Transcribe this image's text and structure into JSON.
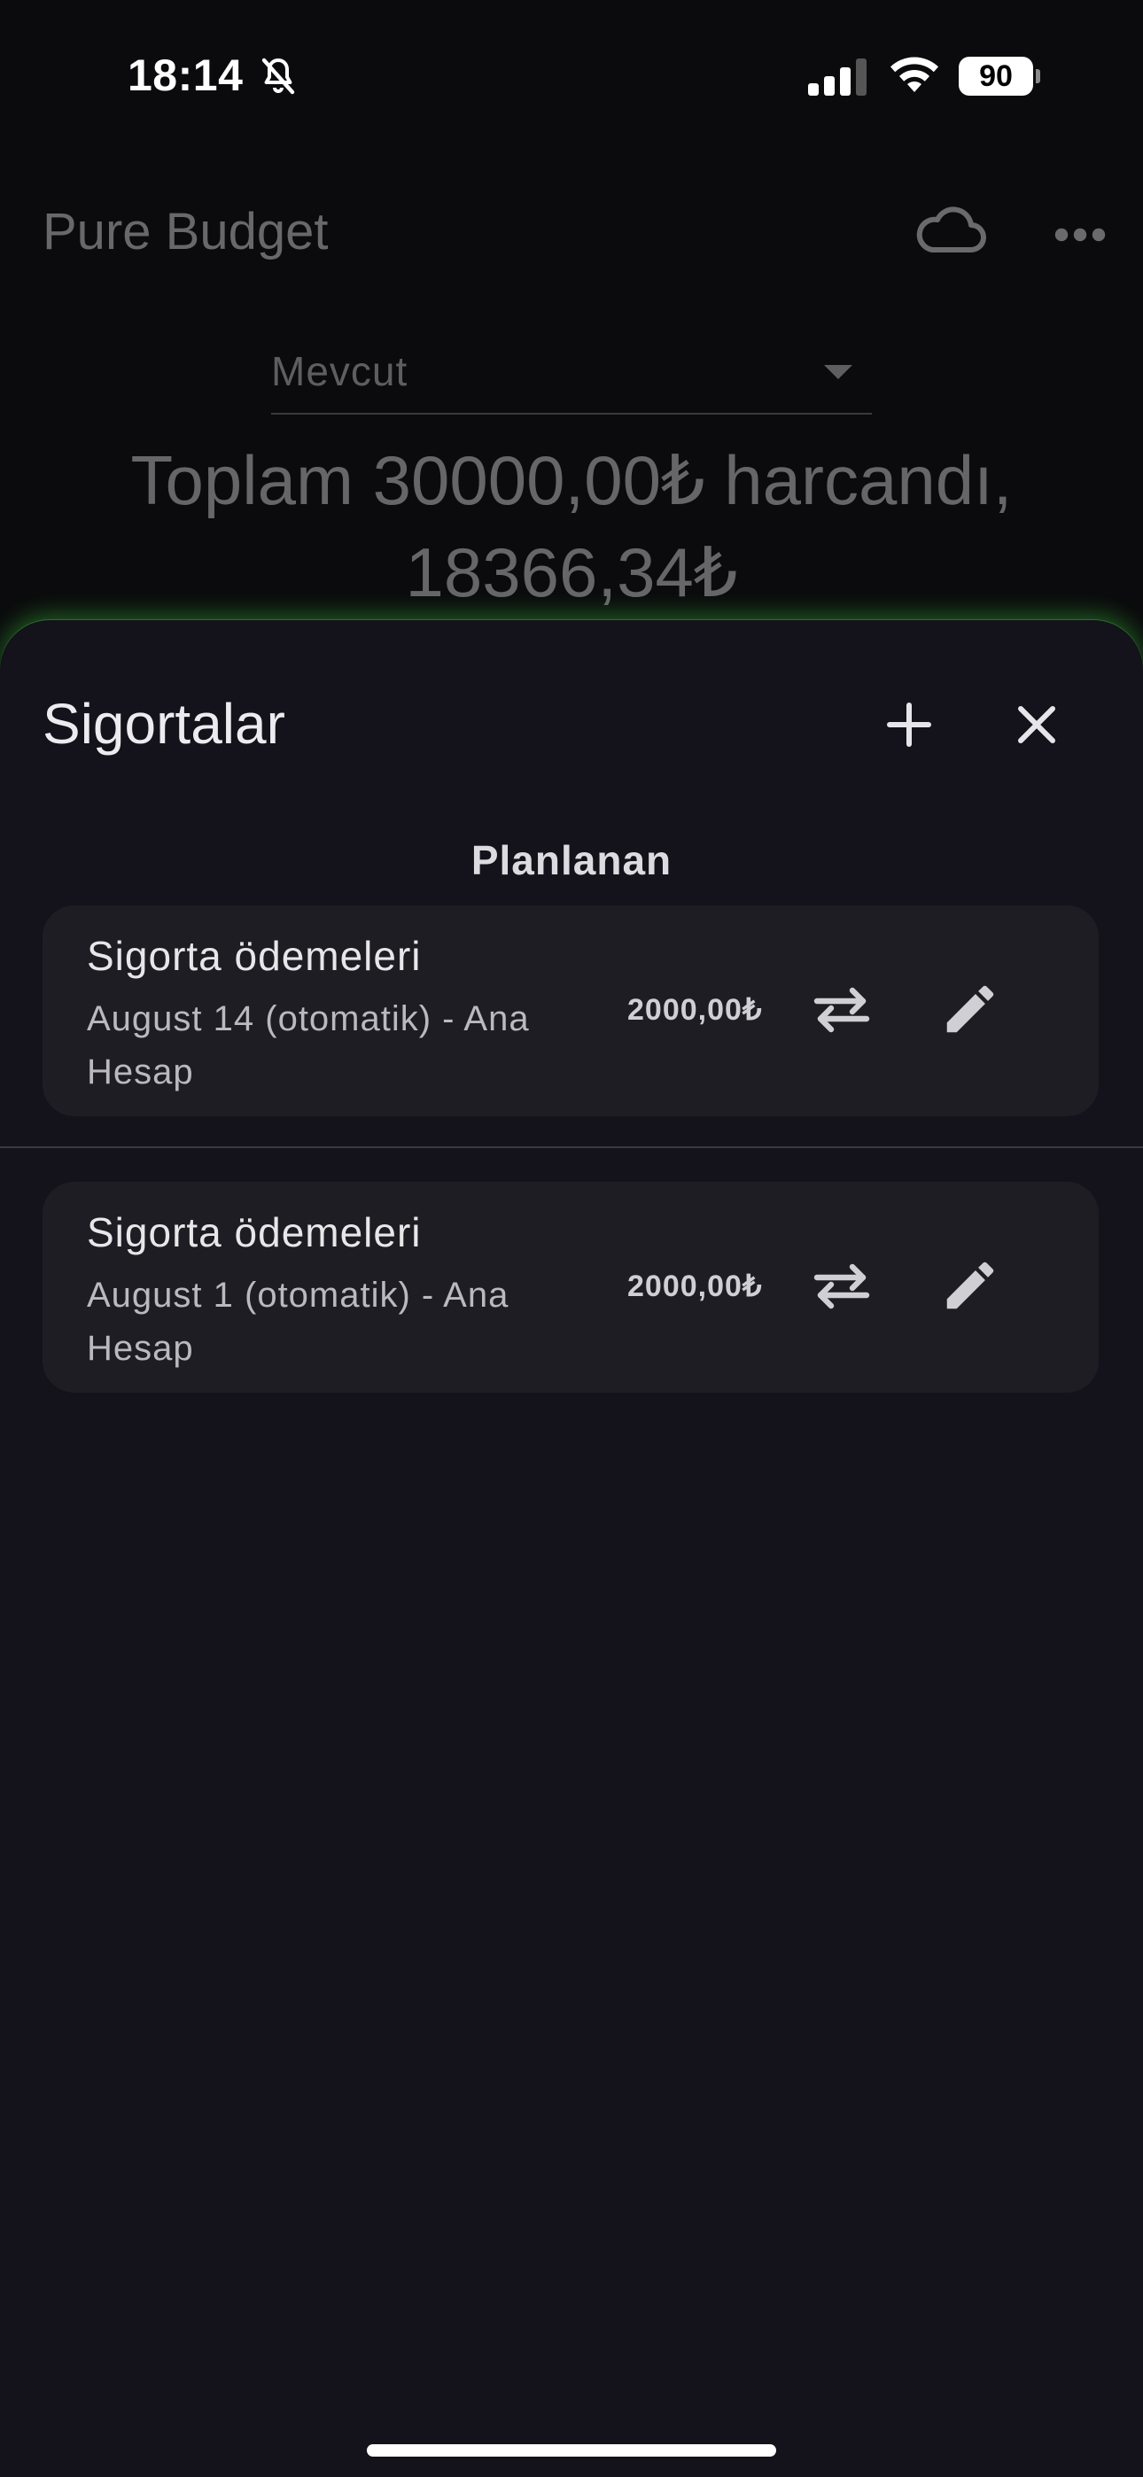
{
  "status_bar": {
    "time": "18:14",
    "battery": "90"
  },
  "background_app": {
    "title": "Pure Budget",
    "period_select": {
      "value": "Mevcut"
    },
    "summary_line1": "Toplam 30000,00₺ harcandı,",
    "summary_line2": "18366,34₺"
  },
  "sheet": {
    "title": "Sigortalar",
    "section_header": "Planlanan",
    "items": [
      {
        "name": "Sigorta ödemeleri",
        "meta": "August 14 (otomatik) - Ana Hesap",
        "amount": "2000,00₺"
      },
      {
        "name": "Sigorta ödemeleri",
        "meta": "August 1 (otomatik) - Ana Hesap",
        "amount": "2000,00₺"
      }
    ]
  },
  "colors": {
    "sheet_background": "#14121a",
    "card_background": "#1f1d24",
    "glow_accent": "#3cc83c"
  },
  "icons": [
    "bell-slash-icon",
    "cellular-signal-icon",
    "wifi-icon",
    "battery-icon",
    "cloud-icon",
    "more-horizontal-icon",
    "dropdown-caret-icon",
    "plus-icon",
    "close-icon",
    "swap-arrows-icon",
    "pencil-icon"
  ]
}
